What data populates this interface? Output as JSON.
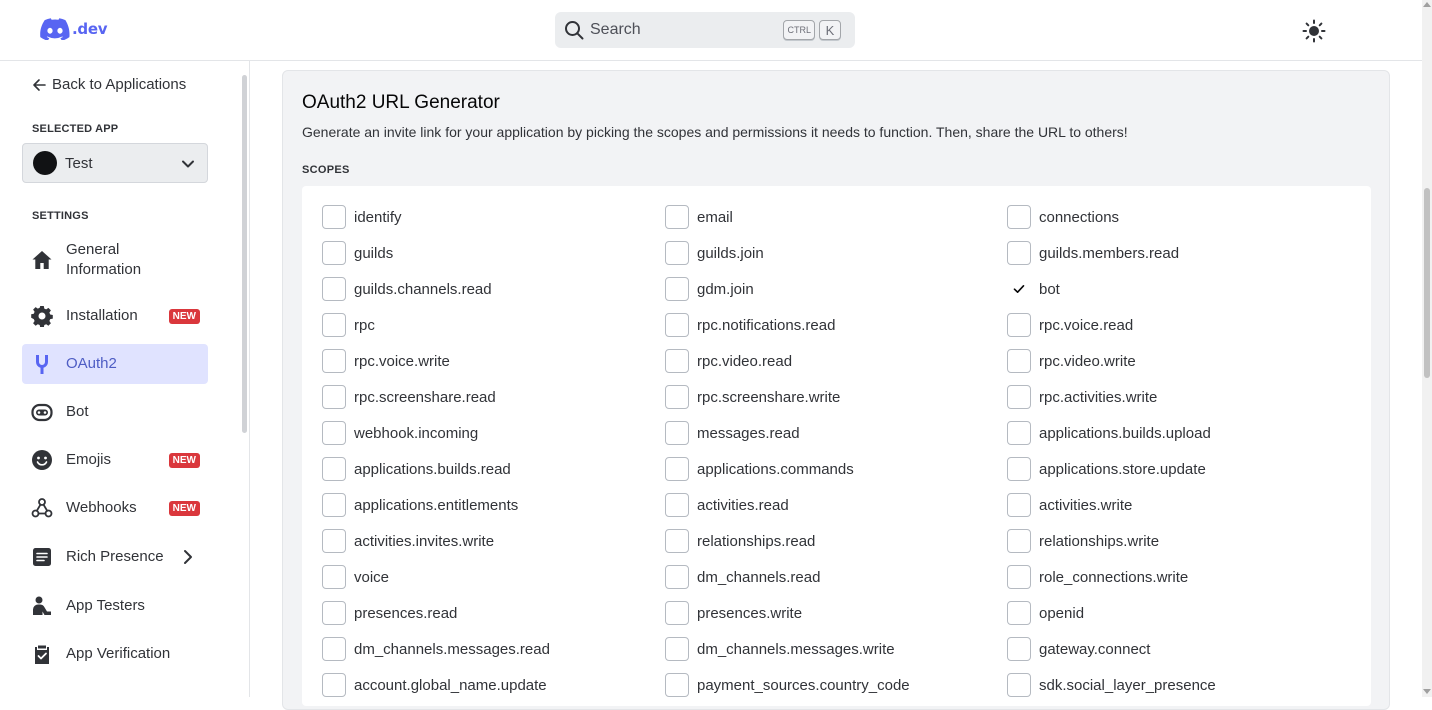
{
  "header": {
    "logo_text": ".dev",
    "search_placeholder": "Search",
    "kbd_ctrl": "CTRL",
    "kbd_k": "K"
  },
  "sidebar": {
    "back_label": "Back to Applications",
    "selected_app_label": "SELECTED APP",
    "selected_app": "Test",
    "settings_label": "SETTINGS",
    "items": [
      {
        "label": "General Information",
        "icon": "home-icon"
      },
      {
        "label": "Installation",
        "icon": "gear-icon",
        "badge": "NEW"
      },
      {
        "label": "OAuth2",
        "icon": "wrench-icon",
        "active": true
      },
      {
        "label": "Bot",
        "icon": "robot-icon"
      },
      {
        "label": "Emojis",
        "icon": "smile-icon",
        "badge": "NEW"
      },
      {
        "label": "Webhooks",
        "icon": "webhook-icon",
        "badge": "NEW"
      },
      {
        "label": "Rich Presence",
        "icon": "document-icon"
      },
      {
        "label": "App Testers",
        "icon": "person-icon"
      },
      {
        "label": "App Verification",
        "icon": "clipboard-check-icon"
      }
    ]
  },
  "main": {
    "title": "OAuth2 URL Generator",
    "description": "Generate an invite link for your application by picking the scopes and permissions it needs to function. Then, share the URL to others!",
    "scopes_label": "SCOPES",
    "scopes": [
      [
        {
          "label": "identify",
          "checked": false
        },
        {
          "label": "email",
          "checked": false
        },
        {
          "label": "connections",
          "checked": false
        }
      ],
      [
        {
          "label": "guilds",
          "checked": false
        },
        {
          "label": "guilds.join",
          "checked": false
        },
        {
          "label": "guilds.members.read",
          "checked": false
        }
      ],
      [
        {
          "label": "guilds.channels.read",
          "checked": false
        },
        {
          "label": "gdm.join",
          "checked": false
        },
        {
          "label": "bot",
          "checked": true
        }
      ],
      [
        {
          "label": "rpc",
          "checked": false
        },
        {
          "label": "rpc.notifications.read",
          "checked": false
        },
        {
          "label": "rpc.voice.read",
          "checked": false
        }
      ],
      [
        {
          "label": "rpc.voice.write",
          "checked": false
        },
        {
          "label": "rpc.video.read",
          "checked": false
        },
        {
          "label": "rpc.video.write",
          "checked": false
        }
      ],
      [
        {
          "label": "rpc.screenshare.read",
          "checked": false
        },
        {
          "label": "rpc.screenshare.write",
          "checked": false
        },
        {
          "label": "rpc.activities.write",
          "checked": false
        }
      ],
      [
        {
          "label": "webhook.incoming",
          "checked": false
        },
        {
          "label": "messages.read",
          "checked": false
        },
        {
          "label": "applications.builds.upload",
          "checked": false
        }
      ],
      [
        {
          "label": "applications.builds.read",
          "checked": false
        },
        {
          "label": "applications.commands",
          "checked": false
        },
        {
          "label": "applications.store.update",
          "checked": false
        }
      ],
      [
        {
          "label": "applications.entitlements",
          "checked": false
        },
        {
          "label": "activities.read",
          "checked": false
        },
        {
          "label": "activities.write",
          "checked": false
        }
      ],
      [
        {
          "label": "activities.invites.write",
          "checked": false
        },
        {
          "label": "relationships.read",
          "checked": false
        },
        {
          "label": "relationships.write",
          "checked": false
        }
      ],
      [
        {
          "label": "voice",
          "checked": false
        },
        {
          "label": "dm_channels.read",
          "checked": false
        },
        {
          "label": "role_connections.write",
          "checked": false
        }
      ],
      [
        {
          "label": "presences.read",
          "checked": false
        },
        {
          "label": "presences.write",
          "checked": false
        },
        {
          "label": "openid",
          "checked": false
        }
      ],
      [
        {
          "label": "dm_channels.messages.read",
          "checked": false
        },
        {
          "label": "dm_channels.messages.write",
          "checked": false
        },
        {
          "label": "gateway.connect",
          "checked": false
        }
      ],
      [
        {
          "label": "account.global_name.update",
          "checked": false
        },
        {
          "label": "payment_sources.country_code",
          "checked": false
        },
        {
          "label": "sdk.social_layer_presence",
          "checked": false
        }
      ]
    ]
  },
  "colors": {
    "brand": "#5865f2",
    "active_bg": "#e0e3ff",
    "badge_red": "#da373c",
    "card_bg": "#f2f3f5"
  }
}
